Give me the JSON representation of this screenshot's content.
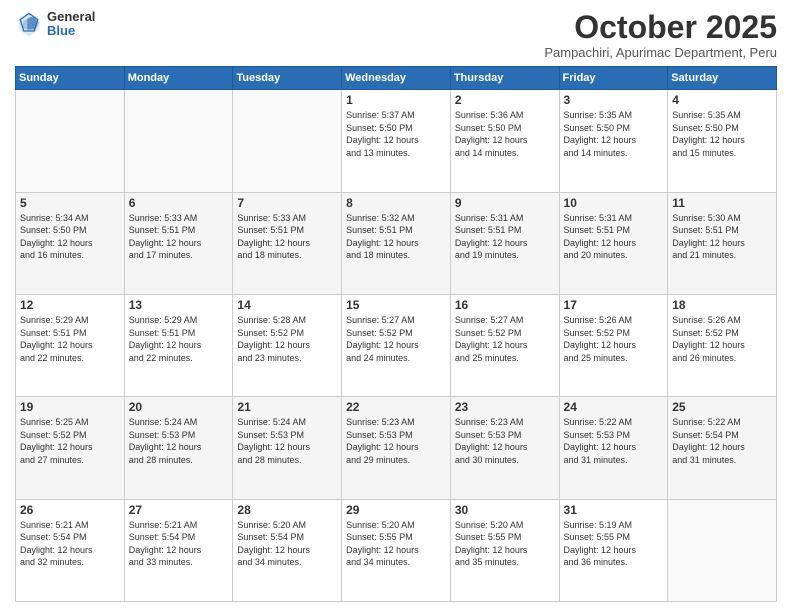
{
  "logo": {
    "general": "General",
    "blue": "Blue"
  },
  "title": "October 2025",
  "subtitle": "Pampachiri, Apurimac Department, Peru",
  "days_of_week": [
    "Sunday",
    "Monday",
    "Tuesday",
    "Wednesday",
    "Thursday",
    "Friday",
    "Saturday"
  ],
  "weeks": [
    [
      {
        "day": "",
        "info": ""
      },
      {
        "day": "",
        "info": ""
      },
      {
        "day": "",
        "info": ""
      },
      {
        "day": "1",
        "info": "Sunrise: 5:37 AM\nSunset: 5:50 PM\nDaylight: 12 hours\nand 13 minutes."
      },
      {
        "day": "2",
        "info": "Sunrise: 5:36 AM\nSunset: 5:50 PM\nDaylight: 12 hours\nand 14 minutes."
      },
      {
        "day": "3",
        "info": "Sunrise: 5:35 AM\nSunset: 5:50 PM\nDaylight: 12 hours\nand 14 minutes."
      },
      {
        "day": "4",
        "info": "Sunrise: 5:35 AM\nSunset: 5:50 PM\nDaylight: 12 hours\nand 15 minutes."
      }
    ],
    [
      {
        "day": "5",
        "info": "Sunrise: 5:34 AM\nSunset: 5:50 PM\nDaylight: 12 hours\nand 16 minutes."
      },
      {
        "day": "6",
        "info": "Sunrise: 5:33 AM\nSunset: 5:51 PM\nDaylight: 12 hours\nand 17 minutes."
      },
      {
        "day": "7",
        "info": "Sunrise: 5:33 AM\nSunset: 5:51 PM\nDaylight: 12 hours\nand 18 minutes."
      },
      {
        "day": "8",
        "info": "Sunrise: 5:32 AM\nSunset: 5:51 PM\nDaylight: 12 hours\nand 18 minutes."
      },
      {
        "day": "9",
        "info": "Sunrise: 5:31 AM\nSunset: 5:51 PM\nDaylight: 12 hours\nand 19 minutes."
      },
      {
        "day": "10",
        "info": "Sunrise: 5:31 AM\nSunset: 5:51 PM\nDaylight: 12 hours\nand 20 minutes."
      },
      {
        "day": "11",
        "info": "Sunrise: 5:30 AM\nSunset: 5:51 PM\nDaylight: 12 hours\nand 21 minutes."
      }
    ],
    [
      {
        "day": "12",
        "info": "Sunrise: 5:29 AM\nSunset: 5:51 PM\nDaylight: 12 hours\nand 22 minutes."
      },
      {
        "day": "13",
        "info": "Sunrise: 5:29 AM\nSunset: 5:51 PM\nDaylight: 12 hours\nand 22 minutes."
      },
      {
        "day": "14",
        "info": "Sunrise: 5:28 AM\nSunset: 5:52 PM\nDaylight: 12 hours\nand 23 minutes."
      },
      {
        "day": "15",
        "info": "Sunrise: 5:27 AM\nSunset: 5:52 PM\nDaylight: 12 hours\nand 24 minutes."
      },
      {
        "day": "16",
        "info": "Sunrise: 5:27 AM\nSunset: 5:52 PM\nDaylight: 12 hours\nand 25 minutes."
      },
      {
        "day": "17",
        "info": "Sunrise: 5:26 AM\nSunset: 5:52 PM\nDaylight: 12 hours\nand 25 minutes."
      },
      {
        "day": "18",
        "info": "Sunrise: 5:26 AM\nSunset: 5:52 PM\nDaylight: 12 hours\nand 26 minutes."
      }
    ],
    [
      {
        "day": "19",
        "info": "Sunrise: 5:25 AM\nSunset: 5:52 PM\nDaylight: 12 hours\nand 27 minutes."
      },
      {
        "day": "20",
        "info": "Sunrise: 5:24 AM\nSunset: 5:53 PM\nDaylight: 12 hours\nand 28 minutes."
      },
      {
        "day": "21",
        "info": "Sunrise: 5:24 AM\nSunset: 5:53 PM\nDaylight: 12 hours\nand 28 minutes."
      },
      {
        "day": "22",
        "info": "Sunrise: 5:23 AM\nSunset: 5:53 PM\nDaylight: 12 hours\nand 29 minutes."
      },
      {
        "day": "23",
        "info": "Sunrise: 5:23 AM\nSunset: 5:53 PM\nDaylight: 12 hours\nand 30 minutes."
      },
      {
        "day": "24",
        "info": "Sunrise: 5:22 AM\nSunset: 5:53 PM\nDaylight: 12 hours\nand 31 minutes."
      },
      {
        "day": "25",
        "info": "Sunrise: 5:22 AM\nSunset: 5:54 PM\nDaylight: 12 hours\nand 31 minutes."
      }
    ],
    [
      {
        "day": "26",
        "info": "Sunrise: 5:21 AM\nSunset: 5:54 PM\nDaylight: 12 hours\nand 32 minutes."
      },
      {
        "day": "27",
        "info": "Sunrise: 5:21 AM\nSunset: 5:54 PM\nDaylight: 12 hours\nand 33 minutes."
      },
      {
        "day": "28",
        "info": "Sunrise: 5:20 AM\nSunset: 5:54 PM\nDaylight: 12 hours\nand 34 minutes."
      },
      {
        "day": "29",
        "info": "Sunrise: 5:20 AM\nSunset: 5:55 PM\nDaylight: 12 hours\nand 34 minutes."
      },
      {
        "day": "30",
        "info": "Sunrise: 5:20 AM\nSunset: 5:55 PM\nDaylight: 12 hours\nand 35 minutes."
      },
      {
        "day": "31",
        "info": "Sunrise: 5:19 AM\nSunset: 5:55 PM\nDaylight: 12 hours\nand 36 minutes."
      },
      {
        "day": "",
        "info": ""
      }
    ]
  ]
}
